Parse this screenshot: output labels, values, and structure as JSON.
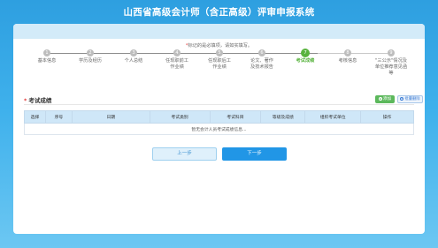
{
  "header": {
    "title": "山西省高级会计师（含正高级）评审申报系统"
  },
  "notice": {
    "marker": "*",
    "text": "标记的是必填项，请如实填写。"
  },
  "steps": [
    {
      "num": "1",
      "label": "基本信息"
    },
    {
      "num": "2",
      "label": "学历及经历"
    },
    {
      "num": "3",
      "label": "个人总结"
    },
    {
      "num": "4",
      "label": "任现职前工作业绩"
    },
    {
      "num": "5",
      "label": "任现职后工作业绩"
    },
    {
      "num": "6",
      "label": "论文、著作及技术报告"
    },
    {
      "num": "7",
      "label": "考试成绩"
    },
    {
      "num": "8",
      "label": "考核信息"
    },
    {
      "num": "9",
      "label": "\"三公示\"情况及单位推荐意见函等"
    }
  ],
  "active_step": 7,
  "section": {
    "marker": "*",
    "title": "考试成绩",
    "add_label": "添加",
    "batch_delete_label": "批量删除"
  },
  "table": {
    "columns": [
      "选择",
      "序号",
      "日期",
      "考试类别",
      "考试科目",
      "等级及成绩",
      "组织考试单位",
      "操作"
    ],
    "empty_text": "暂无会计人员考试成绩信息..."
  },
  "nav": {
    "prev_label": "上一步",
    "next_label": "下一步"
  },
  "colors": {
    "accent_blue": "#2196e6",
    "active_green": "#58b33e",
    "add_green": "#5cb85c",
    "required_red": "#e23a3a"
  },
  "icons": {
    "add": "plus-circle-icon",
    "batch_delete": "minus-circle-icon"
  }
}
